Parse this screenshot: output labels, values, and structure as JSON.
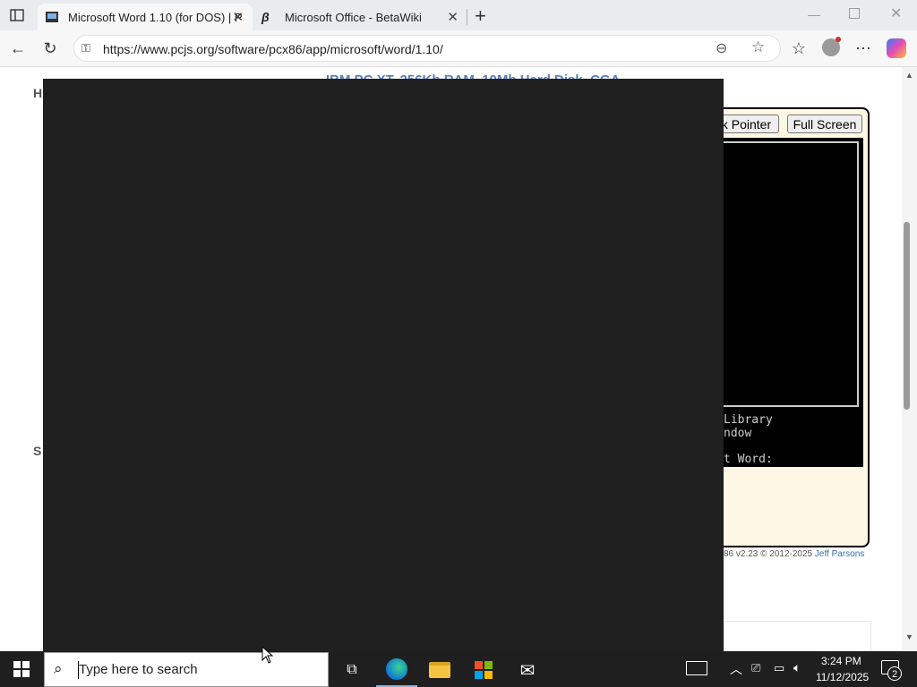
{
  "tabs": [
    {
      "title": "Microsoft Word 1.10 (for DOS) | P",
      "active": true
    },
    {
      "title": "Microsoft Office - BetaWiki",
      "active": false
    }
  ],
  "address": {
    "url": "https://www.pcjs.org/software/pcx86/app/microsoft/word/1.10/"
  },
  "page": {
    "partial_heading": "IBM PC XT, 256Kb RAM, 10Mb Hard Disk, CGA",
    "left_letter_1": "H",
    "left_letter_2": "S",
    "buttons": {
      "lock_pointer": "ck Pointer",
      "full_screen": "Full Screen"
    },
    "dos_lines": [
      "Library",
      "ndow",
      "t Word:"
    ],
    "footer_prefix": "86 v2.23 © 2012-2025 ",
    "footer_author": "Jeff Parsons"
  },
  "taskbar": {
    "search_placeholder": "Type here to search",
    "time": "3:24 PM",
    "date": "11/12/2025",
    "notifications": "2"
  },
  "colors": {
    "accent": "#0078d4",
    "overlay": "#202020",
    "taskbar": "#1f1f1f"
  }
}
